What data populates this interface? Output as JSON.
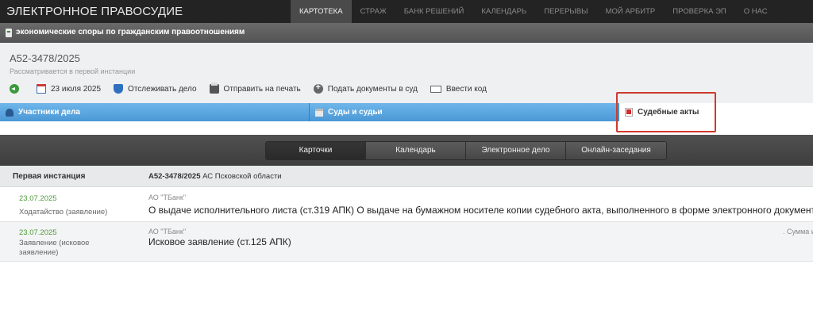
{
  "header": {
    "brand": "ЭЛЕКТРОННОЕ ПРАВОСУДИЕ",
    "nav": [
      {
        "label": "КАРТОТЕКА",
        "active": true
      },
      {
        "label": "СТРАЖ",
        "active": false
      },
      {
        "label": "БАНК РЕШЕНИЙ",
        "active": false
      },
      {
        "label": "КАЛЕНДАРЬ",
        "active": false
      },
      {
        "label": "ПЕРЕРЫВЫ",
        "active": false
      },
      {
        "label": "МОЙ АРБИТР",
        "active": false
      },
      {
        "label": "ПРОВЕРКА ЭП",
        "active": false
      },
      {
        "label": "О НАС",
        "active": false
      }
    ]
  },
  "category": {
    "label": "экономические споры по гражданским правоотношениям"
  },
  "case": {
    "number": "А52-3478/2025",
    "status": "Рассматривается в первой инстанции",
    "toolbar": {
      "back_icon": "back-arrow-icon",
      "date": "23 июля 2025",
      "track": "Отслеживать дело",
      "print": "Отправить на печать",
      "submit": "Подать документы в суд",
      "code": "Ввести код"
    }
  },
  "tabs": {
    "participants": "Участники дела",
    "courts": "Суды и судьи",
    "acts": "Судебные акты",
    "highlight_color": "#d0392b"
  },
  "segments": [
    "Карточки",
    "Календарь",
    "Электронное дело",
    "Онлайн-заседания"
  ],
  "instance": {
    "label": "Первая инстанция",
    "case_number": "А52-3478/2025",
    "court": "АС Псковской области"
  },
  "documents": [
    {
      "date": "23.07.2025",
      "type": "Ходатайство (заявление)",
      "party": "АО \"ТБанк\"",
      "title": "О выдаче исполнительного листа (ст.319 АПК) О выдаче на бумажном носителе копии судебного акта, выполненного в форме электронного документа",
      "extra": ""
    },
    {
      "date": "23.07.2025",
      "type": "Заявление (исковое заявление)",
      "party": "АО \"ТБанк\"",
      "title": "Исковое заявление (ст.125 АПК)",
      "extra": ". Сумма и"
    }
  ],
  "colors": {
    "tab_blue": "#4a98d6",
    "date_green": "#4f9a3a",
    "topbar": "#232323"
  }
}
